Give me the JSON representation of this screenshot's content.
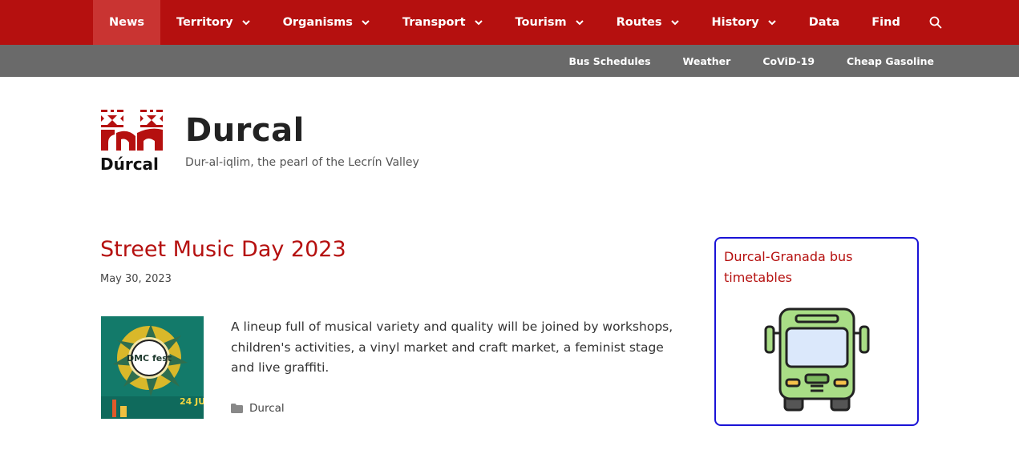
{
  "nav": {
    "items": [
      {
        "label": "News",
        "has_dropdown": false,
        "active": true
      },
      {
        "label": "Territory",
        "has_dropdown": true,
        "active": false
      },
      {
        "label": "Organisms",
        "has_dropdown": true,
        "active": false
      },
      {
        "label": "Transport",
        "has_dropdown": true,
        "active": false
      },
      {
        "label": "Tourism",
        "has_dropdown": true,
        "active": false
      },
      {
        "label": "Routes",
        "has_dropdown": true,
        "active": false
      },
      {
        "label": "History",
        "has_dropdown": true,
        "active": false
      },
      {
        "label": "Data",
        "has_dropdown": false,
        "active": false
      },
      {
        "label": "Find",
        "has_dropdown": false,
        "active": false
      }
    ],
    "search_icon": "search-icon"
  },
  "subnav": {
    "items": [
      "Bus Schedules",
      "Weather",
      "CoViD-19",
      "Cheap Gasoline"
    ]
  },
  "header": {
    "logo_text": "Dúrcal",
    "title": "Durcal",
    "tagline": "Dur-al-iqlim, the pearl of the Lecrín Valley"
  },
  "post": {
    "title": "Street Music Day 2023",
    "date": "May 30, 2023",
    "thumbnail_text": "DMC fest",
    "thumbnail_date": "24 JU",
    "excerpt": "A lineup full of musical variety and quality will be joined by workshops, children's activities, a vinyl market and craft market, a feminist stage and live graffiti.",
    "category": "Durcal"
  },
  "widget": {
    "title": "Durcal-Granada bus timetables",
    "icon": "bus-icon"
  },
  "colors": {
    "brand_red": "#b5100f",
    "nav_active": "#c93432",
    "subnav_bg": "#6a6a6a",
    "widget_border": "#1a13d6"
  }
}
